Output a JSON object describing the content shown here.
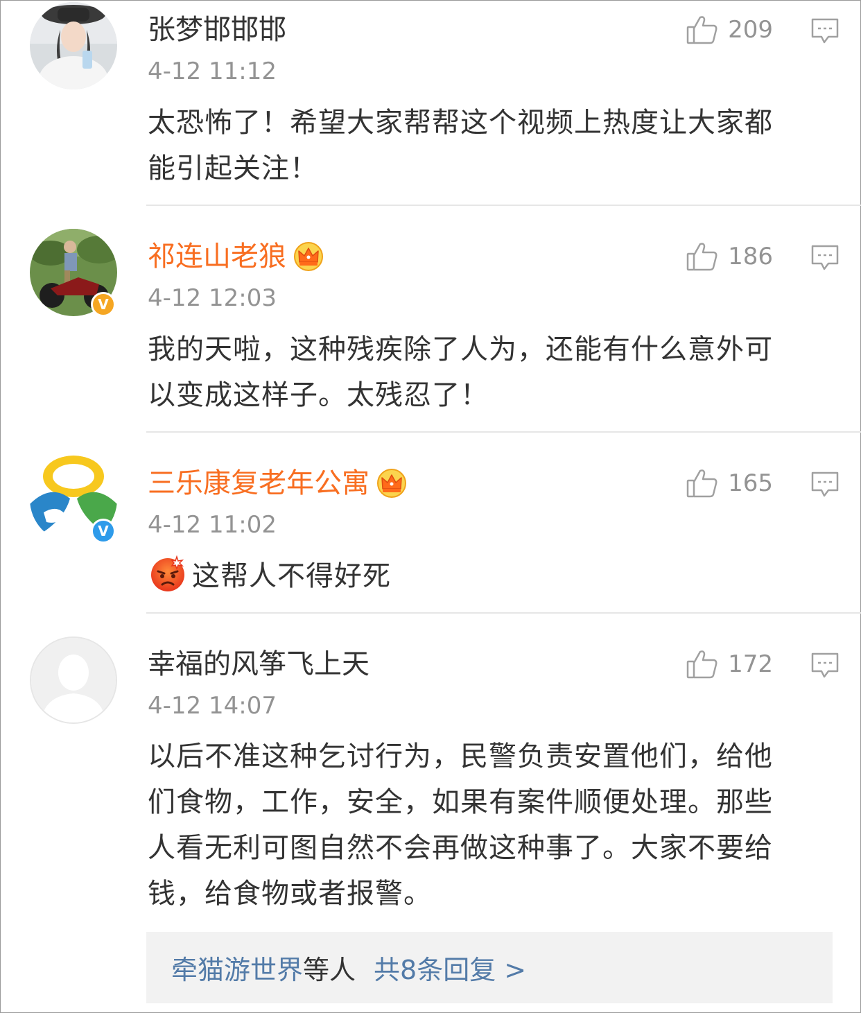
{
  "comments": [
    {
      "username": "张梦邯邯邯",
      "vip": false,
      "verified": false,
      "time": "4-12 11:12",
      "likes": "209",
      "text_lines": [
        "太恐怖了！希望大家帮帮这个视频上热度让大家都",
        "能引起关注！"
      ]
    },
    {
      "username": "祁连山老狼",
      "vip": true,
      "verified": true,
      "verified_color": "#f5a623",
      "time": "4-12 12:03",
      "likes": "186",
      "text_lines": [
        "我的天啦，这种残疾除了人为，还能有什么意外可",
        "以变成这样子。太残忍了！"
      ]
    },
    {
      "username": "三乐康复老年公寓",
      "vip": true,
      "verified": true,
      "verified_color": "#2e9bea",
      "time": "4-12 11:02",
      "likes": "165",
      "emoji": "angry-face-emoji",
      "text_lines": [
        "这帮人不得好死"
      ]
    },
    {
      "username": "幸福的风筝飞上天",
      "vip": false,
      "verified": false,
      "time": "4-12 14:07",
      "likes": "172",
      "text_lines": [
        "以后不准这种乞讨行为，民警负责安置他们，给他",
        "们食物，工作，安全，如果有案件顺便处理。那些",
        "人看无利可图自然不会再做这种事了。大家不要给",
        "钱，给食物或者报警。"
      ]
    }
  ],
  "replies": {
    "replier": "牵猫游世界",
    "suffix": "等人",
    "count_link": "共8条回复 >"
  },
  "badge_letter": "V",
  "colors": {
    "vip_name": "#f86e21",
    "link": "#537ba8",
    "meta": "#939393",
    "divider": "#e6e6e6"
  }
}
